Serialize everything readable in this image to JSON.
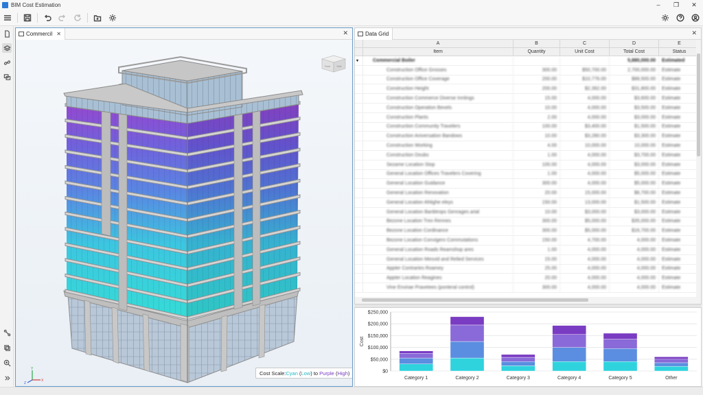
{
  "app": {
    "title": "BIM Cost Estimation"
  },
  "toolbar": {
    "left": [
      "menu-icon",
      "save-icon",
      "undo-icon",
      "redo-icon",
      "redo-alt-icon",
      "open-folder-icon",
      "settings-gear-icon"
    ],
    "right": [
      "settings-icon",
      "help-icon",
      "account-icon"
    ]
  },
  "viewport": {
    "tab_label": "Commercil",
    "legend": {
      "prefix": "Cost Scale: ",
      "low_word": "Cyan",
      "low_paren": "Low",
      "to": " to ",
      "high_word": "Purple",
      "high_paren": "High"
    },
    "viewcube": {
      "left": "Front",
      "right": "Side"
    },
    "axes": {
      "x": "X",
      "y": "Y",
      "z": "Z"
    }
  },
  "grid": {
    "tab_label": "Data Grid",
    "column_letters": [
      "A",
      "B",
      "C",
      "D",
      "E"
    ],
    "columns": [
      "Item",
      "Quantity",
      "Unit Cost",
      "Total Cost",
      "Status"
    ],
    "group": {
      "item": "Commercial Boiler",
      "quantity": "",
      "unit": "",
      "total": "5,880,000.00",
      "status": "Estimated"
    },
    "rows": [
      {
        "item": "Construction Office Grosses",
        "quantity": "300.00",
        "unit": "$50,700.00",
        "total": "2,700,000.00",
        "status": "Estimate"
      },
      {
        "item": "Construction Office Coverage",
        "quantity": "200.00",
        "unit": "$10,776.00",
        "total": "$88,500.00",
        "status": "Estimate"
      },
      {
        "item": "Construction Height",
        "quantity": "200.00",
        "unit": "$2,392.00",
        "total": "$31,800.00",
        "status": "Estimate"
      },
      {
        "item": "Construction Commerce Diverse Inntings",
        "quantity": "15.00",
        "unit": "4,000.00",
        "total": "$3,600.00",
        "status": "Estimate"
      },
      {
        "item": "Construction Operation Bevels",
        "quantity": "10.00",
        "unit": "4,000.00",
        "total": "$3,500.00",
        "status": "Estimate"
      },
      {
        "item": "Construction Plants",
        "quantity": "2.00",
        "unit": "4,000.00",
        "total": "$3,000.00",
        "status": "Estimate"
      },
      {
        "item": "Construction Community Travelers",
        "quantity": "100.00",
        "unit": "$3,400.00",
        "total": "$1,500.00",
        "status": "Estimate"
      },
      {
        "item": "Construction Aniversation Bandows",
        "quantity": "10.00",
        "unit": "$3,280.00",
        "total": "$3,300.00",
        "status": "Estimate"
      },
      {
        "item": "Construction Working",
        "quantity": "4.00",
        "unit": "10,000.00",
        "total": "10,000.00",
        "status": "Estimate"
      },
      {
        "item": "Construction Doubs",
        "quantity": "1.00",
        "unit": "4,000.00",
        "total": "$3,700.00",
        "status": "Estimate"
      },
      {
        "item": "Sezame Location Stop",
        "quantity": "100.00",
        "unit": "4,000.00",
        "total": "$3,000.00",
        "status": "Estimate"
      },
      {
        "item": "General Location Offices Travelers Covering",
        "quantity": "1.00",
        "unit": "4,000.00",
        "total": "$5,000.00",
        "status": "Estimate"
      },
      {
        "item": "General Location Guidance",
        "quantity": "300.00",
        "unit": "4,000.00",
        "total": "$5,000.00",
        "status": "Estimate"
      },
      {
        "item": "General Location Renovation",
        "quantity": "20.00",
        "unit": "15,000.00",
        "total": "$6,700.00",
        "status": "Estimate"
      },
      {
        "item": "General Location Ahtighe eleys",
        "quantity": "150.00",
        "unit": "13,000.00",
        "total": "$1,500.00",
        "status": "Estimate"
      },
      {
        "item": "General Location Banbtrops Genrages arial",
        "quantity": "10.00",
        "unit": "$3,000.00",
        "total": "$3,000.00",
        "status": "Estimate"
      },
      {
        "item": "Bezone Location Trex Rennes",
        "quantity": "300.00",
        "unit": "$5,000.00",
        "total": "$35,000.00",
        "status": "Estimate"
      },
      {
        "item": "Bezone Location Cordinance",
        "quantity": "300.00",
        "unit": "$5,000.00",
        "total": "$16,700.00",
        "status": "Estimate"
      },
      {
        "item": "Bezone Location Convigero Commutations",
        "quantity": "150.00",
        "unit": "4,700.00",
        "total": "4,000.00",
        "status": "Estimate"
      },
      {
        "item": "General Location Roads Reamshop ares",
        "quantity": "1.00",
        "unit": "4,000.00",
        "total": "4,000.00",
        "status": "Estimate"
      },
      {
        "item": "General Location Mesvid and Relied Services",
        "quantity": "15.00",
        "unit": "4,000.00",
        "total": "4,000.00",
        "status": "Estimate"
      },
      {
        "item": "Appter Contraries Roamey",
        "quantity": "25.00",
        "unit": "4,000.00",
        "total": "4,000.00",
        "status": "Estimate"
      },
      {
        "item": "Appter Location Reagines",
        "quantity": "20.00",
        "unit": "4,000.00",
        "total": "4,000.00",
        "status": "Estimate"
      },
      {
        "item": "Vine Envirae Pravetees (ponteral control)",
        "quantity": "300.00",
        "unit": "4,000.00",
        "total": "4,000.00",
        "status": "Estimate"
      }
    ]
  },
  "chart_data": {
    "type": "bar",
    "stacked": true,
    "categories": [
      "Category 1",
      "Category 2",
      "Category 3",
      "Category 4",
      "Category 5",
      "Other"
    ],
    "ylabel": "Cost",
    "xlabel": "",
    "ylim": [
      0,
      200000
    ],
    "yticks": [
      "$0",
      "$50,000",
      "$100,000",
      "$150,000",
      "$200,000",
      "$250,000"
    ],
    "ytick_values": [
      0,
      50000,
      100000,
      150000,
      200000,
      250000
    ],
    "grid": true,
    "colors": [
      "#2fd3de",
      "#5b8ee0",
      "#8a6ad8",
      "#7a3cc2"
    ],
    "series": [
      {
        "values": [
          30000,
          55000,
          22000,
          40000,
          40000,
          20000
        ]
      },
      {
        "values": [
          25000,
          70000,
          18000,
          60000,
          55000,
          15000
        ]
      },
      {
        "values": [
          20000,
          70000,
          18000,
          55000,
          40000,
          15000
        ]
      },
      {
        "values": [
          10000,
          35000,
          12000,
          38000,
          25000,
          10000
        ]
      }
    ]
  }
}
